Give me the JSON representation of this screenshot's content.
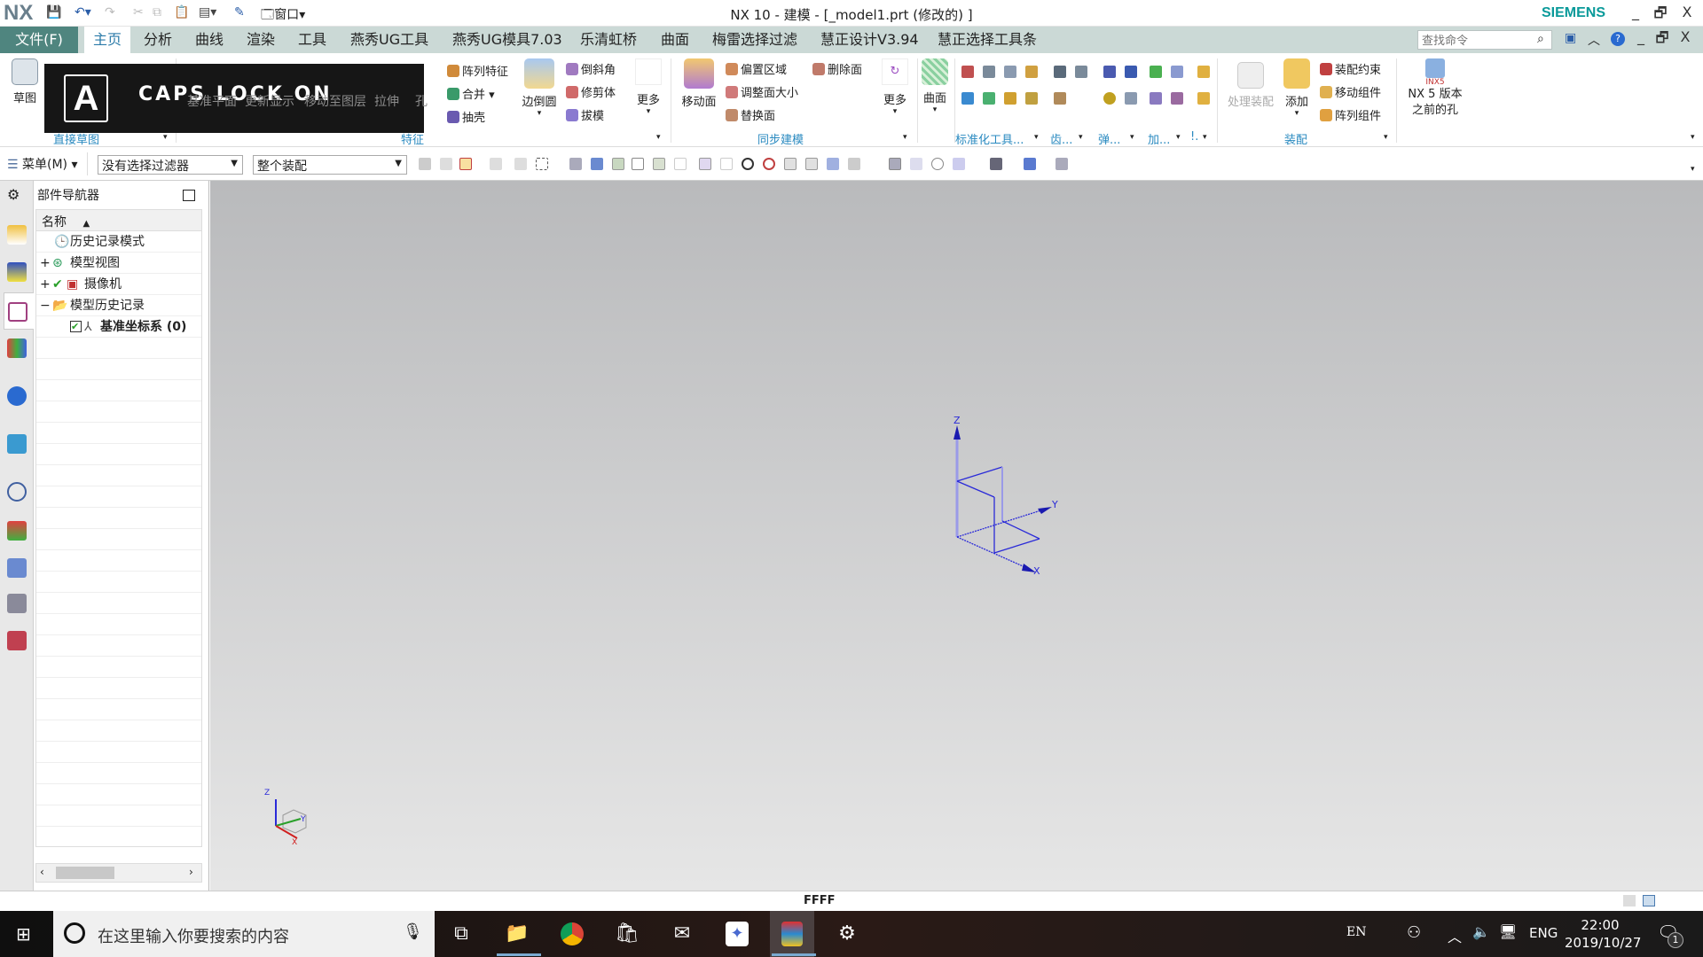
{
  "titlebar": {
    "logo": "NX",
    "window_menu": "窗口",
    "title": "NX 10 - 建模 - [_model1.prt  (修改的) ]",
    "brand": "SIEMENS",
    "minimize": "_",
    "restore": "🗗",
    "close": "X"
  },
  "tabs": {
    "file": "文件(F)",
    "items": [
      "主页",
      "分析",
      "曲线",
      "渲染",
      "工具",
      "燕秀UG工具",
      "燕秀UG模具7.03",
      "乐清虹桥",
      "曲面",
      "梅雷选择过滤",
      "慧正设计V3.94",
      "慧正选择工具条"
    ],
    "active": "主页",
    "search_placeholder": "查找命令"
  },
  "ribbon": {
    "sketch": "草图",
    "sketch_group": "直接草图",
    "feature_hidden": [
      "基准平面",
      "更新显示",
      "移动至图层",
      "拉伸",
      "孔"
    ],
    "feature_items": [
      "阵列特征",
      "合并",
      "抽壳"
    ],
    "edge_blend": "边倒圆",
    "feature_items2": [
      "倒斜角",
      "修剪体",
      "拔模"
    ],
    "more1": "更多",
    "feature_group": "特征",
    "move_face": "移动面",
    "sync_items": [
      "偏置区域",
      "调整面大小",
      "替换面"
    ],
    "delete_face": "删除面",
    "more2": "更多",
    "sync_group": "同步建模",
    "surface": "曲面",
    "std_group": "标准化工具...",
    "gear_group": "齿...",
    "spring_group": "弹...",
    "add_group": "加...",
    "misc_group": "!.",
    "process_asm": "处理装配",
    "add": "添加",
    "asm_items": [
      "装配约束",
      "移动组件",
      "阵列组件"
    ],
    "asm_group": "装配",
    "nx5_badge": "INX5",
    "nx5_hole": "NX 5 版本\n之前的孔"
  },
  "caps": {
    "letter": "A",
    "text": "CAPS LOCK ON"
  },
  "toolbar2": {
    "menu": "菜单(M)",
    "filter": "没有选择过滤器",
    "scope": "整个装配"
  },
  "navigator": {
    "title": "部件导航器",
    "column": "名称",
    "rows": [
      {
        "label": "历史记录模式",
        "expander": ""
      },
      {
        "label": "模型视图",
        "expander": "+"
      },
      {
        "label": "摄像机",
        "expander": "+"
      },
      {
        "label": "模型历史记录",
        "expander": "−"
      },
      {
        "label": "基准坐标系 (0)",
        "expander": ""
      }
    ]
  },
  "viewport": {
    "axes": {
      "x": "X",
      "y": "Y",
      "z": "Z"
    }
  },
  "statusbar": {
    "text": "FFFF"
  },
  "taskbar": {
    "search_placeholder": "在这里输入你要搜索的内容",
    "ime": "EN",
    "lang": "ENG",
    "time": "22:00",
    "date": "2019/10/27",
    "notifications": "1"
  }
}
